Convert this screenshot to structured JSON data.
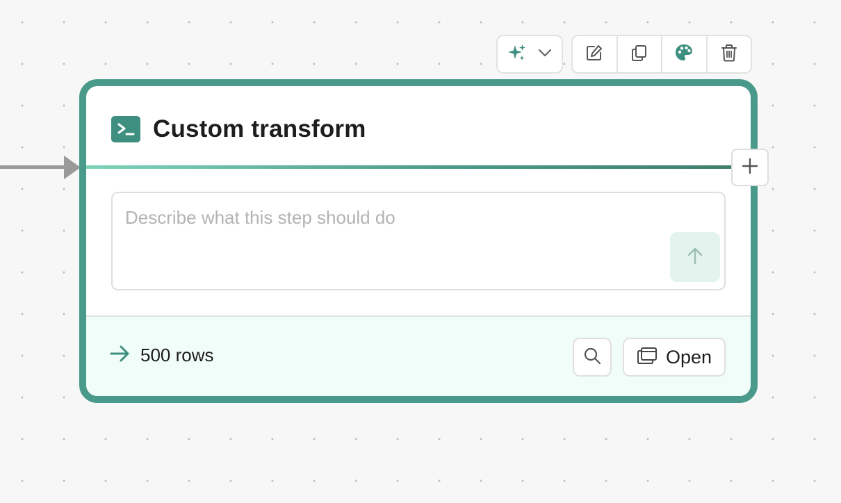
{
  "toolbar": {
    "ai_icon": "sparkles-icon",
    "ai_dropdown_icon": "chevron-down-icon",
    "buttons": [
      {
        "icon": "edit-icon"
      },
      {
        "icon": "copy-icon"
      },
      {
        "icon": "palette-icon"
      },
      {
        "icon": "trash-icon"
      }
    ]
  },
  "node": {
    "icon": "terminal-icon",
    "title": "Custom transform",
    "prompt": {
      "placeholder": "Describe what this step should do",
      "value": "",
      "send_icon": "arrow-up-icon"
    },
    "footer": {
      "rows_icon": "arrow-right-icon",
      "rows_label": "500 rows",
      "search_icon": "search-icon",
      "open_icon": "window-stack-icon",
      "open_label": "Open"
    }
  },
  "add_step_icon": "plus-icon",
  "colors": {
    "accent": "#4a9a8b",
    "accent_dark": "#3e8f80",
    "footer_bg": "#f1fdf8",
    "send_bg": "#e3f3ee",
    "canvas_bg": "#f7f7f7"
  }
}
